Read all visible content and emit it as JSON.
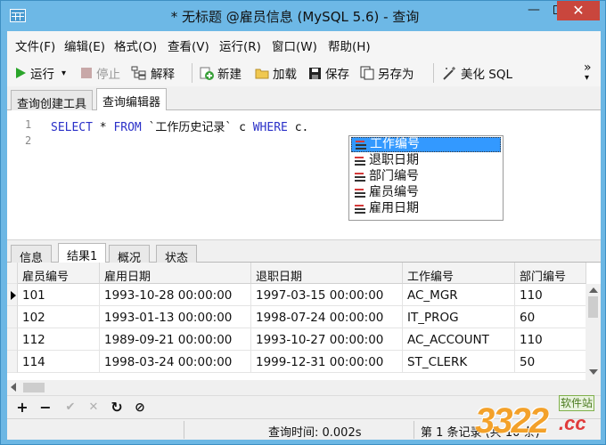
{
  "window": {
    "title": "* 无标题 @雇员信息 (MySQL 5.6) - 查询",
    "min": "—",
    "close": "✕"
  },
  "menu": [
    "文件(F)",
    "编辑(E)",
    "格式(O)",
    "查看(V)",
    "运行(R)",
    "窗口(W)",
    "帮助(H)"
  ],
  "toolbar": {
    "run": "运行",
    "stop": "停止",
    "explain": "解释",
    "new": "新建",
    "load": "加载",
    "save": "保存",
    "save_as": "另存为",
    "beautify": "美化 SQL",
    "more": "»",
    "dropdown": "▾"
  },
  "editor_tabs": [
    "查询创建工具",
    "查询编辑器"
  ],
  "editor": {
    "line_numbers": [
      "1",
      "2"
    ],
    "code": {
      "select": "SELECT",
      "star": " * ",
      "from": "FROM",
      "table": " `工作历史记录` c ",
      "where": "WHERE",
      "tail": " c."
    },
    "autocomplete": [
      "工作编号",
      "退职日期",
      "部门编号",
      "雇员编号",
      "雇用日期"
    ]
  },
  "result_tabs": [
    "信息",
    "结果1",
    "概况",
    "状态"
  ],
  "grid": {
    "columns": [
      "雇员编号",
      "雇用日期",
      "退职日期",
      "工作编号",
      "部门编号"
    ],
    "rows": [
      [
        "101",
        "1993-10-28 00:00:00",
        "1997-03-15 00:00:00",
        "AC_MGR",
        "110"
      ],
      [
        "102",
        "1993-01-13 00:00:00",
        "1998-07-24 00:00:00",
        "IT_PROG",
        "60"
      ],
      [
        "112",
        "1989-09-21 00:00:00",
        "1993-10-27 00:00:00",
        "AC_ACCOUNT",
        "110"
      ],
      [
        "114",
        "1998-03-24 00:00:00",
        "1999-12-31 00:00:00",
        "ST_CLERK",
        "50"
      ]
    ]
  },
  "nav": [
    "+",
    "−",
    "✔",
    "✕",
    "↻",
    "⊘"
  ],
  "status": {
    "query_time": "查询时间: 0.002s",
    "record": "第 1 条记录 (共 10 条)"
  },
  "watermark": {
    "number": "3322",
    "suffix": ".cc",
    "tag": "软件站"
  },
  "colors": {
    "keyword": "#2a30c8",
    "selection": "#3399ff",
    "title_bar": "#6db8e6",
    "close_button": "#c9463d"
  }
}
